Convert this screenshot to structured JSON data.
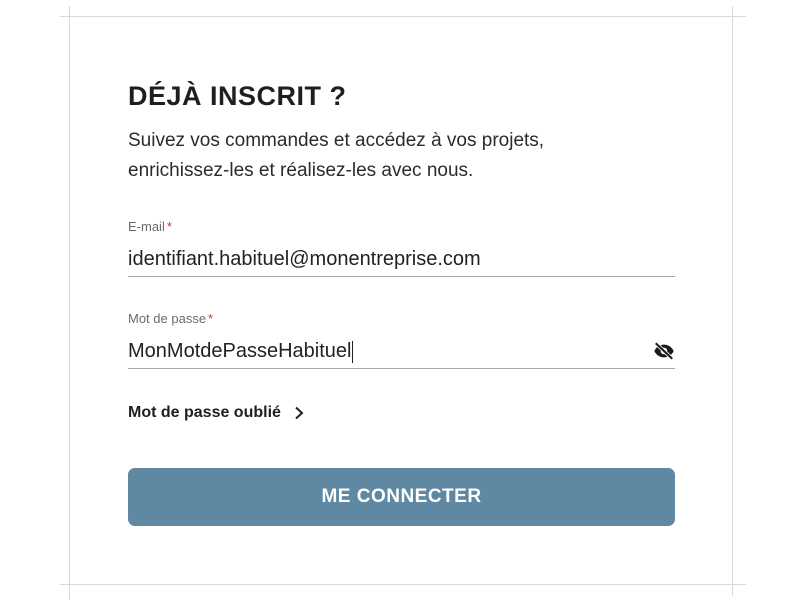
{
  "login": {
    "title": "DÉJÀ INSCRIT ?",
    "subtitle_line1": "Suivez vos commandes et accédez à vos projets,",
    "subtitle_line2": "enrichissez-les et réalisez-les avec nous.",
    "email": {
      "label": "E-mail",
      "required_mark": "*",
      "value": "identifiant.habituel@monentreprise.com"
    },
    "password": {
      "label": "Mot de passe",
      "required_mark": "*",
      "value": "MonMotdePasseHabituel",
      "toggle_icon": "eye-slash-icon"
    },
    "forgot_link": "Mot de passe oublié",
    "forgot_icon": "chevron-right-icon",
    "submit_label": "ME CONNECTER"
  },
  "colors": {
    "accent_button": "#5f88a2",
    "required_asterisk": "#c0392b",
    "text": "#1f1f1f"
  }
}
